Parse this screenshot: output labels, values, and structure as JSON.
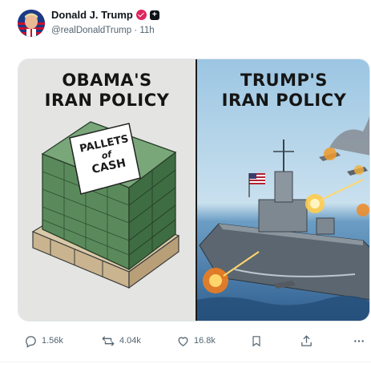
{
  "post": {
    "author": {
      "display_name": "Donald J. Trump",
      "handle": "@realDonaldTrump",
      "separator": "·",
      "time_ago": "11h"
    },
    "media": {
      "left_title_line1": "OBAMA'S",
      "left_title_line2": "IRAN POLICY",
      "right_title_line1": "TRUMP'S",
      "right_title_line2": "IRAN POLICY",
      "sign_line1": "PALLETS",
      "sign_line2": "of",
      "sign_line3": "CASH"
    },
    "actions": {
      "replies": "1.56k",
      "reposts": "4.04k",
      "likes": "16.8k"
    }
  },
  "colors": {
    "verified": "#e0245e",
    "text_primary": "#0f1419",
    "text_secondary": "#536471",
    "sky": "#9cc6e3",
    "sea": "#305f90",
    "cash_green": "#4f7d52"
  },
  "icons": [
    "reply-icon",
    "repost-icon",
    "like-icon",
    "bookmark-icon",
    "share-icon",
    "more-icon",
    "verified-badge-icon",
    "affiliate-badge-icon"
  ]
}
